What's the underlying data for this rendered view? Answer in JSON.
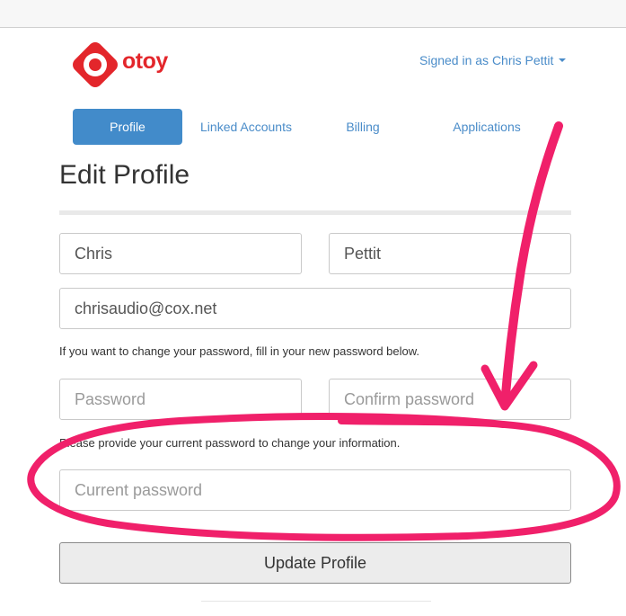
{
  "brand": {
    "name": "otoy",
    "color": "#e3262b"
  },
  "header": {
    "signed_in_text": "Signed in as Chris Pettit"
  },
  "tabs": [
    {
      "label": "Profile",
      "active": true
    },
    {
      "label": "Linked Accounts",
      "active": false
    },
    {
      "label": "Billing",
      "active": false
    },
    {
      "label": "Applications",
      "active": false
    }
  ],
  "page": {
    "title": "Edit Profile"
  },
  "form": {
    "first_name": {
      "value": "Chris"
    },
    "last_name": {
      "value": "Pettit"
    },
    "email": {
      "value": "chrisaudio@cox.net"
    },
    "password_help": "If you want to change your password, fill in your new password below.",
    "password": {
      "placeholder": "Password"
    },
    "confirm_password": {
      "placeholder": "Confirm password"
    },
    "current_help": "Please provide your current password to change your information.",
    "current_password": {
      "placeholder": "Current password"
    },
    "submit_label": "Update Profile"
  },
  "colors": {
    "accent": "#428bca",
    "link": "#4a8cc9",
    "annotation": "#f0206a"
  }
}
